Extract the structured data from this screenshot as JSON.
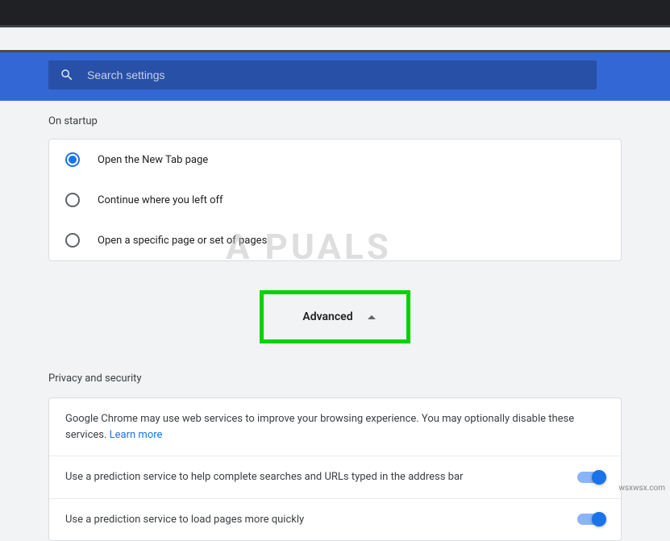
{
  "search": {
    "placeholder": "Search settings"
  },
  "sections": {
    "startup": {
      "title": "On startup",
      "options": [
        {
          "label": "Open the New Tab page",
          "selected": true
        },
        {
          "label": "Continue where you left off",
          "selected": false
        },
        {
          "label": "Open a specific page or set of pages",
          "selected": false
        }
      ]
    },
    "advanced": {
      "label": "Advanced",
      "expanded": true
    },
    "privacy": {
      "title": "Privacy and security",
      "intro_text": "Google Chrome may use web services to improve your browsing experience. You may optionally disable these services. ",
      "learn_more": "Learn more",
      "items": [
        {
          "label": "Use a prediction service to help complete searches and URLs typed in the address bar",
          "enabled": true
        },
        {
          "label": "Use a prediction service to load pages more quickly",
          "enabled": true
        }
      ]
    }
  },
  "watermark": "A   PUALS",
  "source": "wsxwsx.com",
  "highlight_color": "#00d400",
  "accent_color": "#1a73e8"
}
